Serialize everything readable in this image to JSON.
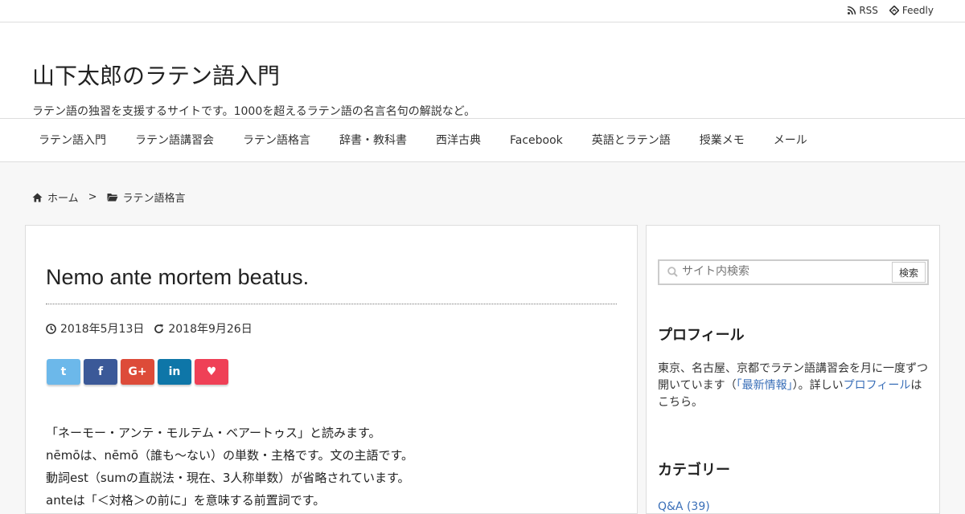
{
  "topbar": {
    "feeds": [
      {
        "icon": "rss-icon",
        "label": "RSS"
      },
      {
        "icon": "feedly-icon",
        "label": "Feedly"
      }
    ]
  },
  "header": {
    "title": "山下太郎のラテン語入門",
    "tagline": "ラテン語の独習を支援するサイトです。1000を超えるラテン語の名言名句の解説など。"
  },
  "nav": {
    "items": [
      "ラテン語入門",
      "ラテン語講習会",
      "ラテン語格言",
      "辞書・教科書",
      "西洋古典",
      "Facebook",
      "英語とラテン語",
      "授業メモ",
      "メール"
    ]
  },
  "breadcrumb": {
    "home": "ホーム",
    "separator": ">",
    "category": "ラテン語格言"
  },
  "post": {
    "title": "Nemo ante mortem beatus.",
    "published": "2018年5月13日",
    "updated": "2018年9月26日",
    "share_buttons": [
      {
        "name": "twitter",
        "glyph": "t",
        "color": "#6cb8ea"
      },
      {
        "name": "facebook",
        "glyph": "f",
        "color": "#3b5998"
      },
      {
        "name": "google-plus",
        "glyph": "G+",
        "color": "#dd4b39"
      },
      {
        "name": "linkedin",
        "glyph": "in",
        "color": "#0e76a8"
      },
      {
        "name": "pocket",
        "glyph": "♥",
        "color": "#ef4056"
      }
    ],
    "lines": [
      "「ネーモー・アンテ・モルテム・ベアートゥス」と読みます。",
      "nēmōは、nēmō（誰も～ない）の単数・主格です。文の主語です。",
      "動詞est（sumの直説法・現在、3人称単数）が省略されています。",
      "anteは「＜対格＞の前に」を意味する前置詞です。"
    ]
  },
  "sidebar": {
    "search_placeholder": "サイト内検索",
    "search_button": "検索",
    "profile_title": "プロフィール",
    "profile_text_1": "東京、名古屋、京都でラテン語講習会を月に一度ずつ開いています（",
    "profile_link_1": "「最新情報」",
    "profile_text_2": "）。詳しい",
    "profile_link_2": "プロフィール",
    "profile_text_3": "はこちら。",
    "category_title": "カテゴリー",
    "category_first": "Q&A (39)"
  }
}
